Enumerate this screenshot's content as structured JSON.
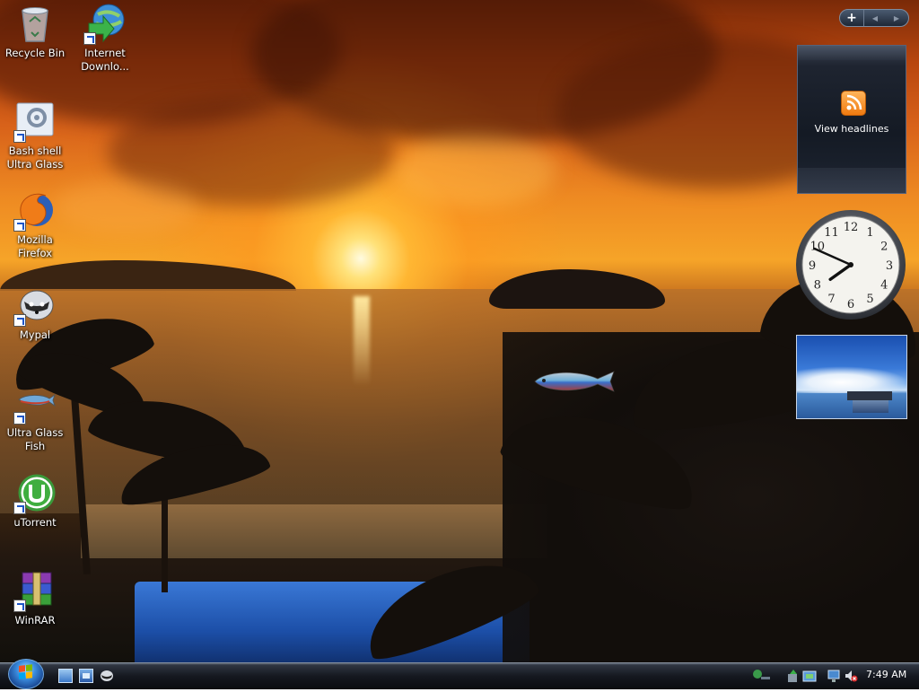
{
  "desktop": {
    "icons": [
      {
        "label": "Recycle Bin",
        "icon": "recycle-bin-icon"
      },
      {
        "label": "Internet\nDownlo...",
        "icon": "internet-download-manager-icon"
      },
      {
        "label": "Bash shell\nUltra Glass",
        "icon": "bash-shell-icon"
      },
      {
        "label": "Mozilla\nFirefox",
        "icon": "firefox-icon"
      },
      {
        "label": "Mypal",
        "icon": "mypal-icon"
      },
      {
        "label": "Ultra Glass\nFish",
        "icon": "ultra-glass-fish-icon"
      },
      {
        "label": "uTorrent",
        "icon": "utorrent-icon"
      },
      {
        "label": "WinRAR",
        "icon": "winrar-icon"
      }
    ]
  },
  "sidebar": {
    "controls": {
      "add": "+"
    },
    "feed_headlines": {
      "text": "View headlines",
      "icon": "rss-icon"
    },
    "clock": {
      "hour": 7,
      "minute": 49
    }
  },
  "taskbar": {
    "start_icon": "windows-start-orb",
    "quick_launch": [
      "show-desktop-icon",
      "switch-windows-icon",
      "mypal-icon"
    ],
    "tray": [
      "network-icon",
      "safely-remove-icon",
      "power-icon",
      "display-icon",
      "volume-muted-icon"
    ],
    "time": "7:49 AM"
  },
  "colors": {
    "accent": "#1e56c8",
    "sun": "#ffe27a",
    "sky": "#d8621a"
  }
}
